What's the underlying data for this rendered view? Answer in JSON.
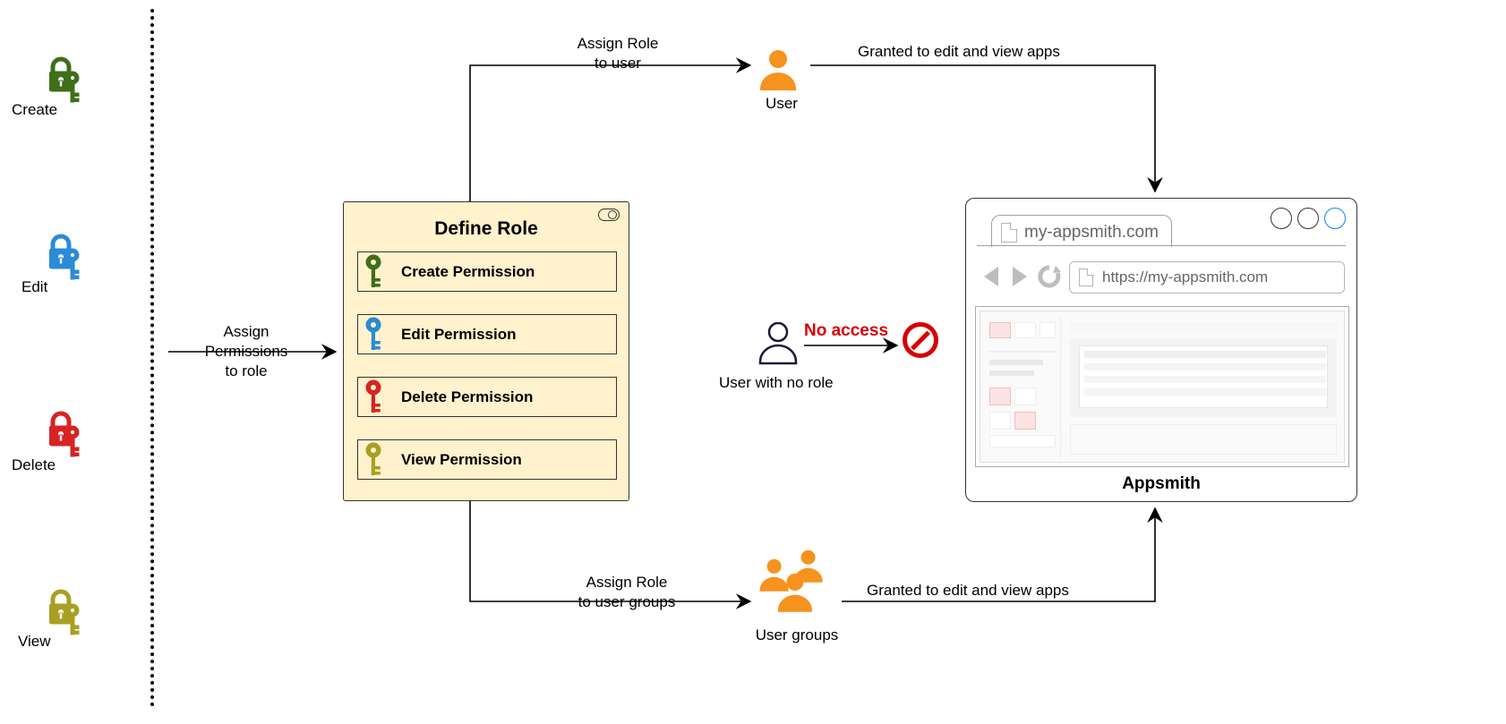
{
  "legend": {
    "create": "Create",
    "edit": "Edit",
    "delete": "Delete",
    "view": "View"
  },
  "colors": {
    "create": "#3f6f1a",
    "edit": "#2b8bd6",
    "delete": "#d62424",
    "view": "#a8a022",
    "user": "#f6921e"
  },
  "assign_perm": {
    "l1": "Assign",
    "l2": "Permissions",
    "l3": "to role"
  },
  "role": {
    "title": "Define Role",
    "perms": {
      "create": "Create Permission",
      "edit": "Edit Permission",
      "delete": "Delete Permission",
      "view": "View Permission"
    }
  },
  "edges": {
    "to_user": {
      "l1": "Assign Role",
      "l2": "to user"
    },
    "to_groups": {
      "l1": "Assign Role",
      "l2": "to user groups"
    },
    "user_to_app": "Granted to edit and view apps",
    "groups_to_app": "Granted to edit and view apps",
    "no_access": "No access"
  },
  "actors": {
    "user": "User",
    "groups": "User groups",
    "norole": "User with no role"
  },
  "browser": {
    "tab": "my-appsmith.com",
    "url": "https://my-appsmith.com",
    "title": "Appsmith"
  }
}
